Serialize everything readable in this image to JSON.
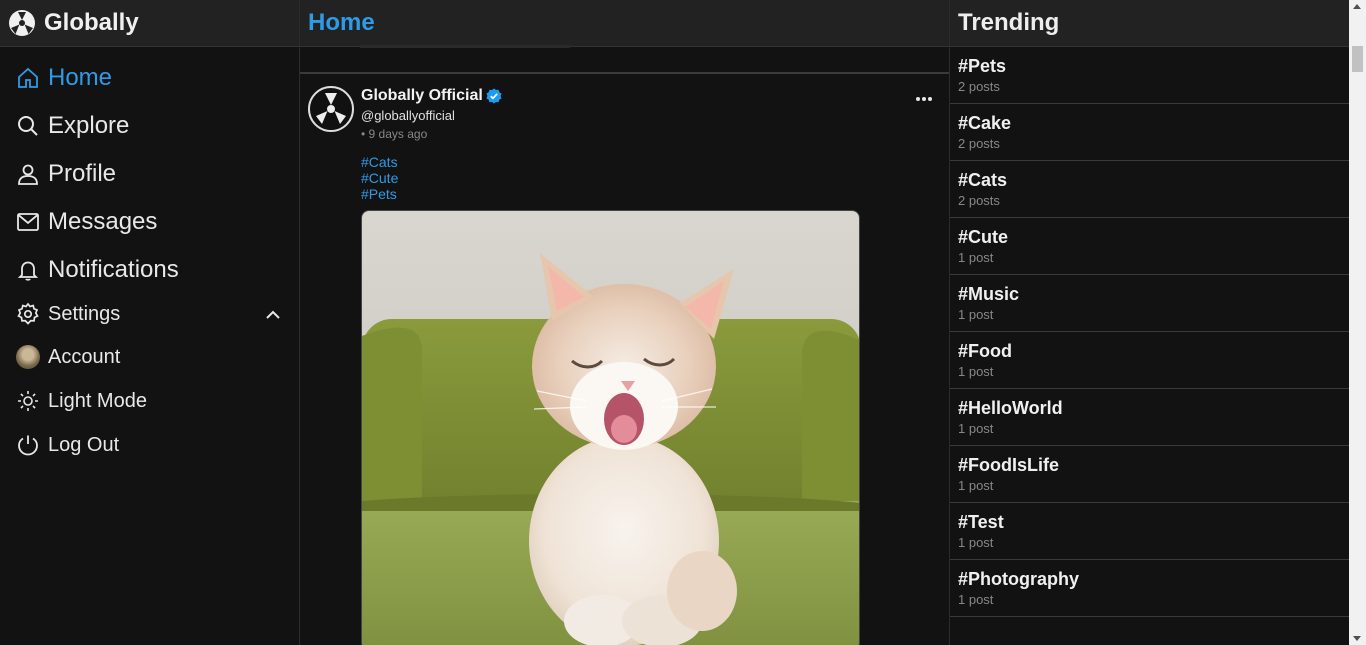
{
  "app": {
    "name": "Globally"
  },
  "nav": {
    "home": "Home",
    "explore": "Explore",
    "profile": "Profile",
    "messages": "Messages",
    "notifications": "Notifications",
    "settings": "Settings",
    "account": "Account",
    "light_mode": "Light Mode",
    "log_out": "Log Out"
  },
  "feed": {
    "title": "Home",
    "post": {
      "author": "Globally Official",
      "handle": "@globallyofficial",
      "time": "• 9 days ago",
      "tags": [
        "#Cats",
        "#Cute",
        "#Pets"
      ],
      "image": "kitten-yawning-on-green-couch"
    }
  },
  "trending": {
    "title": "Trending",
    "items": [
      {
        "tag": "#Pets",
        "count": "2 posts"
      },
      {
        "tag": "#Cake",
        "count": "2 posts"
      },
      {
        "tag": "#Cats",
        "count": "2 posts"
      },
      {
        "tag": "#Cute",
        "count": "1 post"
      },
      {
        "tag": "#Music",
        "count": "1 post"
      },
      {
        "tag": "#Food",
        "count": "1 post"
      },
      {
        "tag": "#HelloWorld",
        "count": "1 post"
      },
      {
        "tag": "#FoodIsLife",
        "count": "1 post"
      },
      {
        "tag": "#Test",
        "count": "1 post"
      },
      {
        "tag": "#Photography",
        "count": "1 post"
      }
    ]
  },
  "colors": {
    "accent": "#2e9be6",
    "background": "#121212",
    "header": "#222222"
  }
}
